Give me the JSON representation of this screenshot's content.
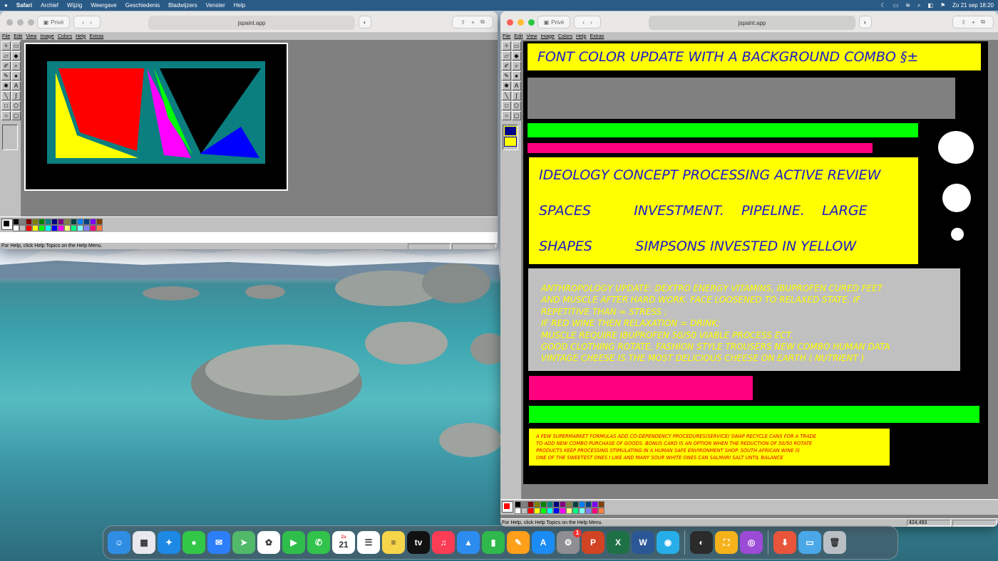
{
  "menubar": {
    "app": "Safari",
    "items": [
      "Archief",
      "Wijzig",
      "Weergave",
      "Geschiedenis",
      "Bladwijzers",
      "Venster",
      "Help"
    ],
    "datetime": "Zo 21 sep 18:20"
  },
  "safari": {
    "private_label": "Privé",
    "url": "jspaint.app"
  },
  "paint": {
    "menus": [
      "File",
      "Edit",
      "View",
      "Image",
      "Colors",
      "Help",
      "Extras"
    ],
    "tools": [
      "free-select",
      "select",
      "eraser",
      "fill",
      "picker",
      "magnifier",
      "pencil",
      "brush",
      "airbrush",
      "text",
      "line",
      "curve",
      "rectangle",
      "polygon",
      "ellipse",
      "rounded-rectangle"
    ],
    "palette": [
      "#000000",
      "#808080",
      "#800000",
      "#808000",
      "#008000",
      "#008080",
      "#000080",
      "#800080",
      "#808040",
      "#004040",
      "#0080ff",
      "#004080",
      "#8000ff",
      "#804000",
      "#ffffff",
      "#c0c0c0",
      "#ff0000",
      "#ffff00",
      "#00ff00",
      "#00ffff",
      "#0000ff",
      "#ff00ff",
      "#ffff80",
      "#00ff80",
      "#80ffff",
      "#8080ff",
      "#ff0080",
      "#ff8040"
    ],
    "status_help": "For Help, click Help Topics on the Help Menu.",
    "coords": "424,493"
  },
  "right_canvas": {
    "heading": "FONT COLOR UPDATE WITH A BACKGROUND COMBO §±",
    "box_lines": [
      "IDEOLOGY CONCEPT PROCESSING ACTIVE REVIEW",
      "SPACES          INVESTMENT.    PIPELINE.    LARGE",
      "SHAPES          SIMPSONS INVESTED IN YELLOW"
    ],
    "gray_lines": [
      "ANTHROPOLOGY UPDATE: DEXTRO ENERGY VITAMINS, IBUPROFEN CURED FEET",
      "AND MUSCLE AFTER HARD WORK. FACE LOOSENED TO RELAXED STATE. IF",
      "REPETITIVE THAN = STRESS ;",
      "IF RED WINE THEN RELAXATION = DRINK;",
      "MUSCLE REQUIRE IBUPROFEN 50/50 VIABLE PROCESS ECT.",
      "GOOD CLOTHING ROTATE, FASHION STYLE TROUSERS NEW COMBO HUMAN DATA",
      "VINTAGE CHEESE IS THE MOST DELICIOUS CHEESE ON EARTH ( NUTRIENT )"
    ],
    "small_lines": [
      "A FEW SUPERMARKET FORMULAS ADD CO-DEPENDENCY PROCEDURES(SERVICE) SWAP RECYCLE CANS FOR A TRADE",
      "TO ADD NEW COMBO PURCHASE OF GOODS. BONUS CARD IS AN OPTION WHEN THE REDUCTION OF 50/50 ROTATE",
      "PRODUCTS KEEP PROCESSING STIMULATING IN A HUMAN SAFE ENVIRONMENT SHOP. SOUTH AFRICAN WINE IS",
      "ONE OF THE SWEETEST ONES I LIKE AND MANY SOUR WHITE ONES CAN SALMARI SALT UNTIL BALANCE"
    ]
  },
  "dock": {
    "items": [
      {
        "name": "finder-icon",
        "bg": "#2f8de4",
        "glyph": "☺"
      },
      {
        "name": "launchpad-icon",
        "bg": "#e8e8ee",
        "glyph": "▦"
      },
      {
        "name": "safari-icon",
        "bg": "#1e88e5",
        "glyph": "✦"
      },
      {
        "name": "messages-icon",
        "bg": "#33c748",
        "glyph": "●"
      },
      {
        "name": "mail-icon",
        "bg": "#2d7ff9",
        "glyph": "✉"
      },
      {
        "name": "maps-icon",
        "bg": "#52b96b",
        "glyph": "➤"
      },
      {
        "name": "photos-icon",
        "bg": "#ffffff",
        "glyph": "✿"
      },
      {
        "name": "facetime-icon",
        "bg": "#2fbe4b",
        "glyph": "▶"
      },
      {
        "name": "phone-icon",
        "bg": "#31c34c",
        "glyph": "✆"
      },
      {
        "name": "calendar-icon",
        "bg": "#ffffff",
        "glyph": "21"
      },
      {
        "name": "reminders-icon",
        "bg": "#ffffff",
        "glyph": "☰"
      },
      {
        "name": "notes-icon",
        "bg": "#f7d54a",
        "glyph": "≡"
      },
      {
        "name": "appletv-icon",
        "bg": "#111111",
        "glyph": "tv"
      },
      {
        "name": "music-icon",
        "bg": "#fa3c55",
        "glyph": "♫"
      },
      {
        "name": "keynote-icon",
        "bg": "#2d8cf0",
        "glyph": "▲"
      },
      {
        "name": "numbers-icon",
        "bg": "#2fb84c",
        "glyph": "▮"
      },
      {
        "name": "pages-icon",
        "bg": "#ff9f1a",
        "glyph": "✎"
      },
      {
        "name": "appstore-icon",
        "bg": "#1c8cf5",
        "glyph": "A"
      },
      {
        "name": "system-settings-icon",
        "bg": "#8e8e93",
        "glyph": "⚙"
      },
      {
        "name": "powerpoint-icon",
        "bg": "#d04423",
        "glyph": "P"
      },
      {
        "name": "excel-icon",
        "bg": "#1e7145",
        "glyph": "X"
      },
      {
        "name": "word-icon",
        "bg": "#2b5797",
        "glyph": "W"
      },
      {
        "name": "finder-alt-icon",
        "bg": "#27aee8",
        "glyph": "◉"
      },
      {
        "name": "sep"
      },
      {
        "name": "scanner-icon",
        "bg": "#2b2b2b",
        "glyph": "◐"
      },
      {
        "name": "skateboard-icon",
        "bg": "#f5b21a",
        "glyph": "⛶"
      },
      {
        "name": "podcasts-icon",
        "bg": "#9b4bd6",
        "glyph": "◎"
      },
      {
        "name": "sep"
      },
      {
        "name": "downloads-icon",
        "bg": "#e8553b",
        "glyph": "⬇"
      },
      {
        "name": "folder-icon",
        "bg": "#4aa8e8",
        "glyph": "▭"
      },
      {
        "name": "trash-icon",
        "bg": "#b9bfc4",
        "glyph": "🗑"
      }
    ],
    "badge": "1",
    "calendar_month": "Zo"
  }
}
